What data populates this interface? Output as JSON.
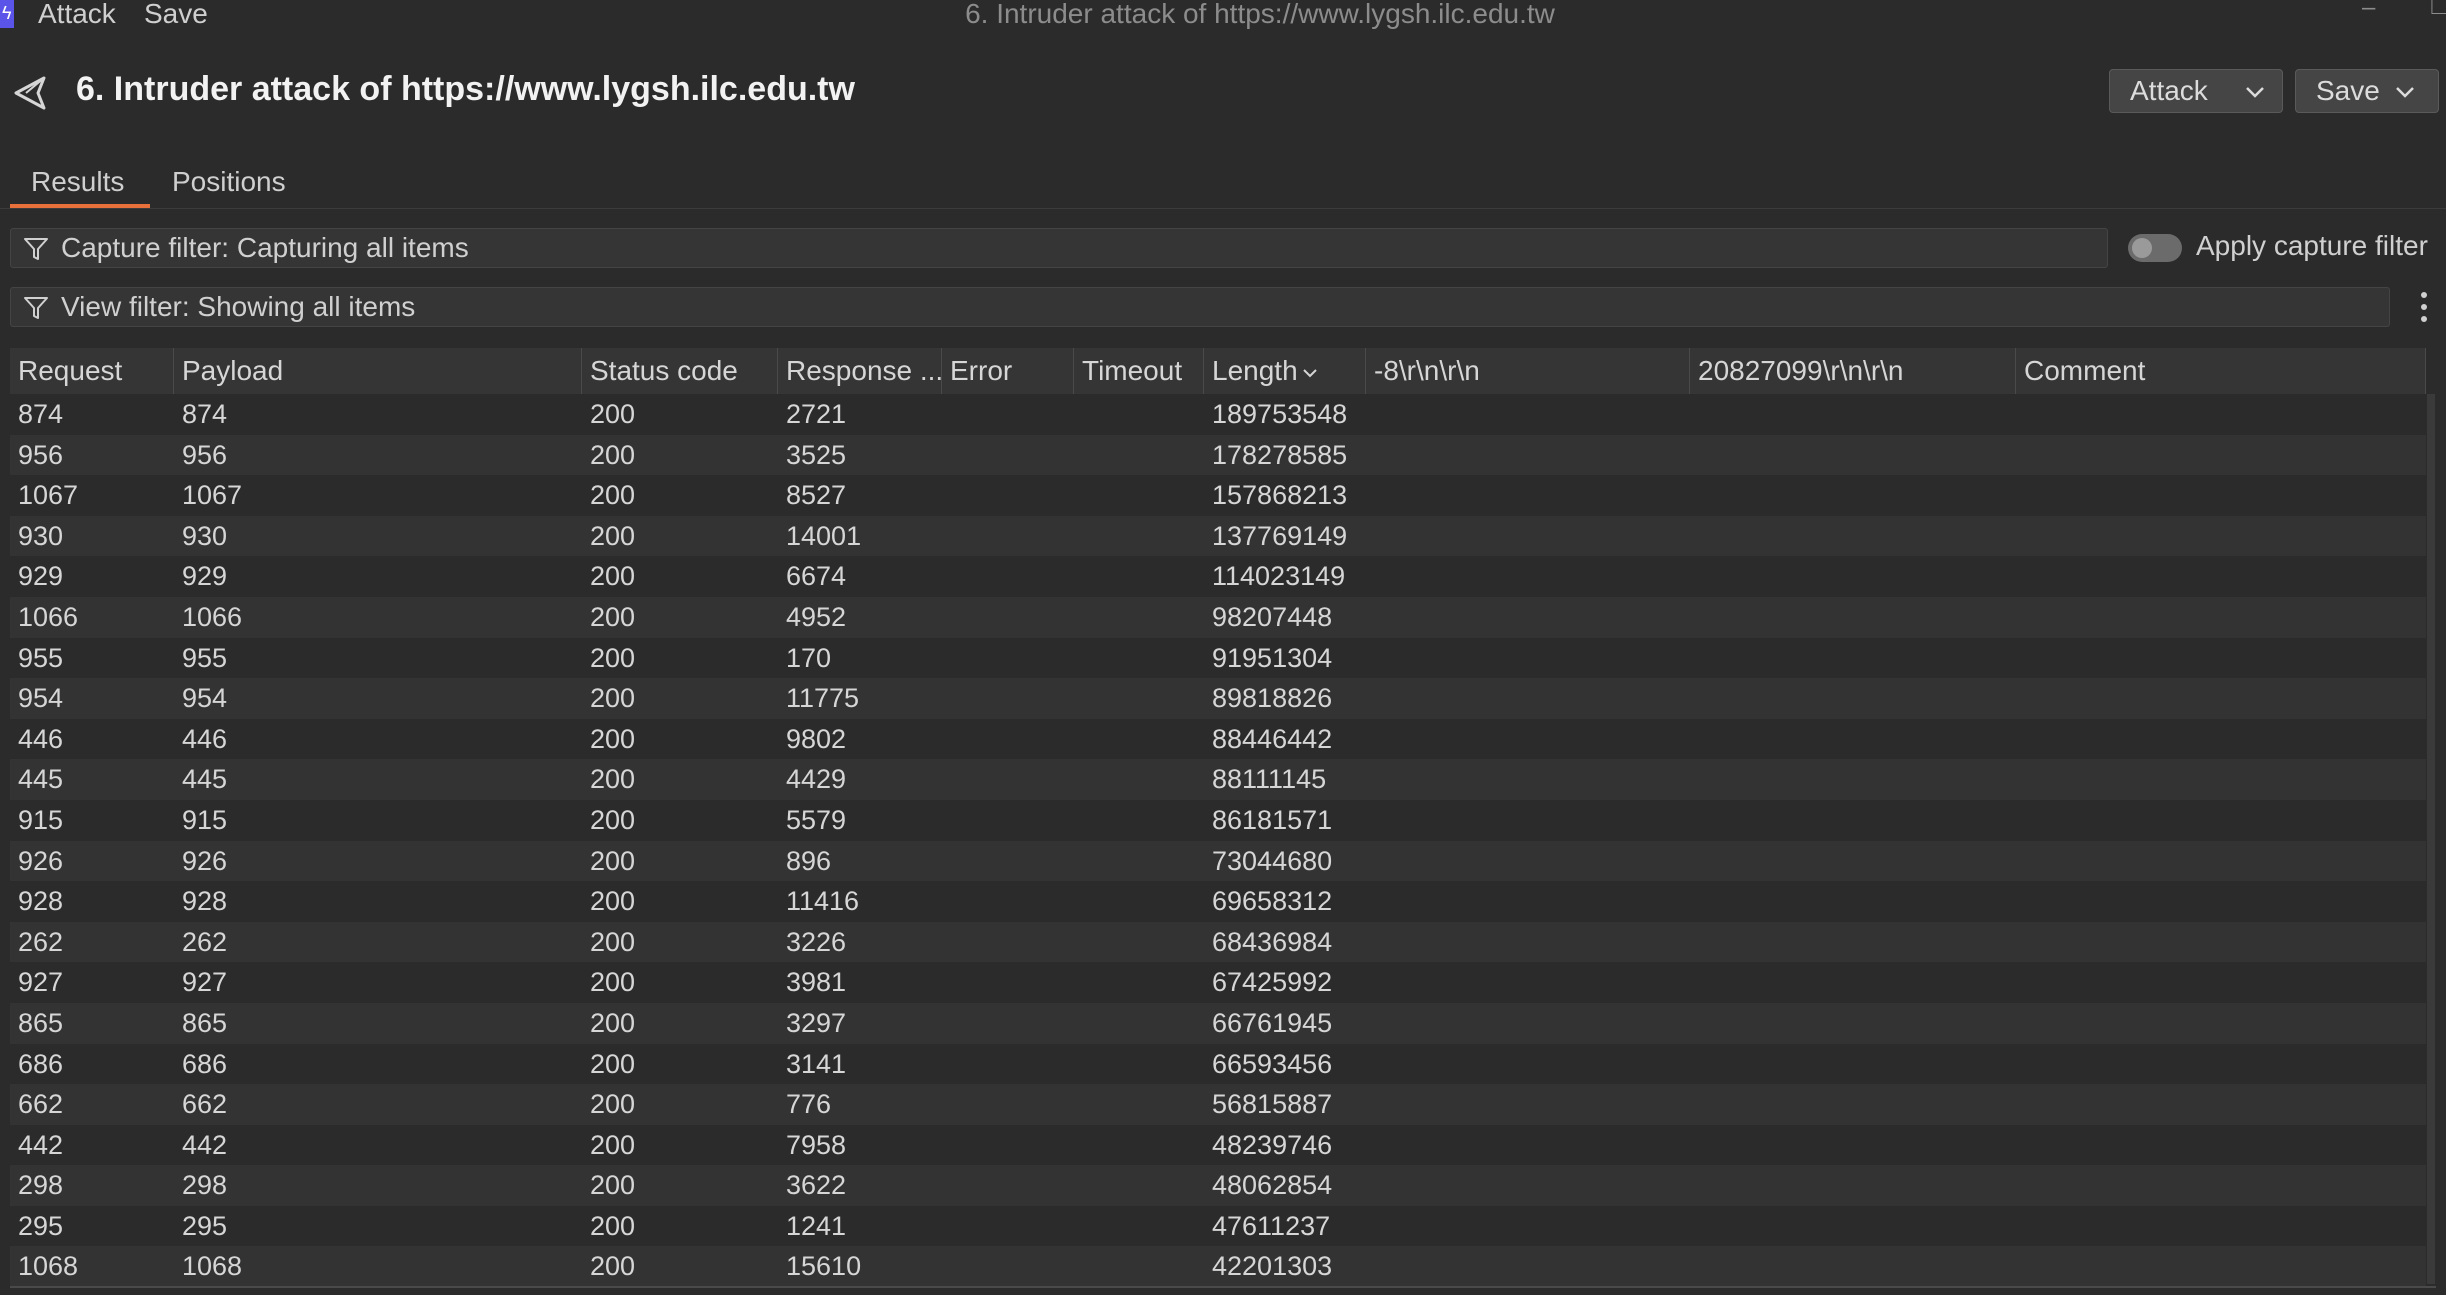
{
  "app": {
    "menu": [
      "Attack",
      "Save"
    ],
    "window_title": "6. Intruder attack of https://www.lygsh.ilc.edu.tw",
    "window_controls": {
      "minimize": "–",
      "restore": "❐"
    }
  },
  "header": {
    "title": "6. Intruder attack of https://www.lygsh.ilc.edu.tw",
    "attack_button": "Attack",
    "save_button": "Save"
  },
  "tabs": [
    {
      "label": "Results",
      "active": true
    },
    {
      "label": "Positions",
      "active": false
    }
  ],
  "capture_filter": {
    "text": "Capture filter: Capturing all items",
    "toggle_label": "Apply capture filter",
    "toggle_on": false
  },
  "view_filter": {
    "text": "View filter: Showing all items"
  },
  "table": {
    "columns": [
      "Request",
      "Payload",
      "Status code",
      "Response ...",
      "Error",
      "Timeout",
      "Length",
      "-8\\r\\n\\r\\n",
      "20827099\\r\\n\\r\\n",
      "Comment"
    ],
    "sorted_column": "Length",
    "rows": [
      [
        "874",
        "874",
        "200",
        "2721",
        "",
        "",
        "189753548",
        "",
        "",
        ""
      ],
      [
        "956",
        "956",
        "200",
        "3525",
        "",
        "",
        "178278585",
        "",
        "",
        ""
      ],
      [
        "1067",
        "1067",
        "200",
        "8527",
        "",
        "",
        "157868213",
        "",
        "",
        ""
      ],
      [
        "930",
        "930",
        "200",
        "14001",
        "",
        "",
        "137769149",
        "",
        "",
        ""
      ],
      [
        "929",
        "929",
        "200",
        "6674",
        "",
        "",
        "114023149",
        "",
        "",
        ""
      ],
      [
        "1066",
        "1066",
        "200",
        "4952",
        "",
        "",
        "98207448",
        "",
        "",
        ""
      ],
      [
        "955",
        "955",
        "200",
        "170",
        "",
        "",
        "91951304",
        "",
        "",
        ""
      ],
      [
        "954",
        "954",
        "200",
        "11775",
        "",
        "",
        "89818826",
        "",
        "",
        ""
      ],
      [
        "446",
        "446",
        "200",
        "9802",
        "",
        "",
        "88446442",
        "",
        "",
        ""
      ],
      [
        "445",
        "445",
        "200",
        "4429",
        "",
        "",
        "88111145",
        "",
        "",
        ""
      ],
      [
        "915",
        "915",
        "200",
        "5579",
        "",
        "",
        "86181571",
        "",
        "",
        ""
      ],
      [
        "926",
        "926",
        "200",
        "896",
        "",
        "",
        "73044680",
        "",
        "",
        ""
      ],
      [
        "928",
        "928",
        "200",
        "11416",
        "",
        "",
        "69658312",
        "",
        "",
        ""
      ],
      [
        "262",
        "262",
        "200",
        "3226",
        "",
        "",
        "68436984",
        "",
        "",
        ""
      ],
      [
        "927",
        "927",
        "200",
        "3981",
        "",
        "",
        "67425992",
        "",
        "",
        ""
      ],
      [
        "865",
        "865",
        "200",
        "3297",
        "",
        "",
        "66761945",
        "",
        "",
        ""
      ],
      [
        "686",
        "686",
        "200",
        "3141",
        "",
        "",
        "66593456",
        "",
        "",
        ""
      ],
      [
        "662",
        "662",
        "200",
        "776",
        "",
        "",
        "56815887",
        "",
        "",
        ""
      ],
      [
        "442",
        "442",
        "200",
        "7958",
        "",
        "",
        "48239746",
        "",
        "",
        ""
      ],
      [
        "298",
        "298",
        "200",
        "3622",
        "",
        "",
        "48062854",
        "",
        "",
        ""
      ],
      [
        "295",
        "295",
        "200",
        "1241",
        "",
        "",
        "47611237",
        "",
        "",
        ""
      ],
      [
        "1068",
        "1068",
        "200",
        "15610",
        "",
        "",
        "42201303",
        "",
        "",
        ""
      ]
    ]
  },
  "colors": {
    "background": "#2b2b2b",
    "accent": "#e8703a",
    "logo": "#5a55e8"
  }
}
